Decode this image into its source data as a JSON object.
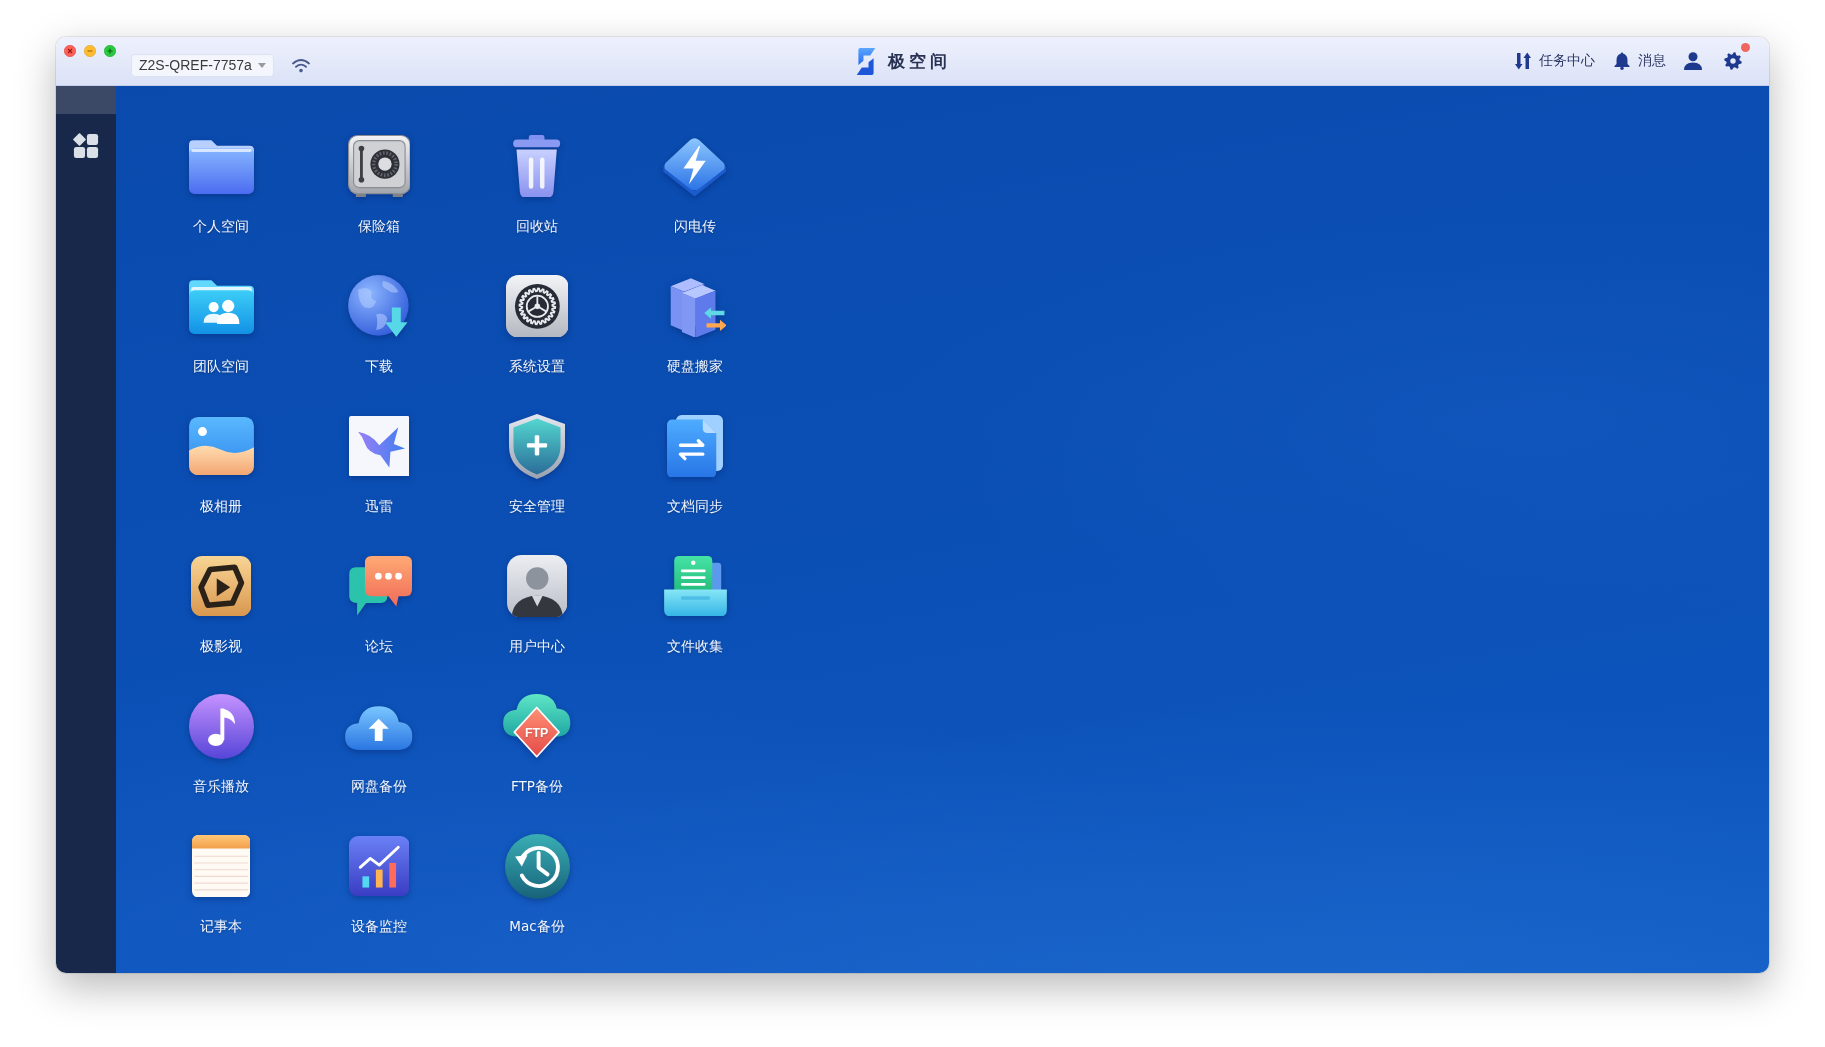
{
  "title_bar": {
    "device": "Z2S-QREF-7757a",
    "title": "极空间",
    "actions": [
      {
        "kind": "tasks",
        "label": "任务中心"
      },
      {
        "kind": "messages",
        "label": "消息"
      },
      {
        "kind": "account"
      },
      {
        "kind": "settings",
        "badge": true
      }
    ]
  },
  "sidebar": {
    "items": [
      {
        "kind": "apps"
      }
    ]
  },
  "desktop": {
    "rows": [
      [
        {
          "label": "个人空间",
          "kind": "folder"
        },
        {
          "label": "保险箱",
          "kind": "safe"
        },
        {
          "label": "回收站",
          "kind": "trash"
        },
        {
          "label": "闪电传",
          "kind": "lightning"
        }
      ],
      [
        {
          "label": "团队空间",
          "kind": "team_folder"
        },
        {
          "label": "下载",
          "kind": "download"
        },
        {
          "label": "系统设置",
          "kind": "settings"
        },
        {
          "label": "硬盘搬家",
          "kind": "drives"
        }
      ],
      [
        {
          "label": "极相册",
          "kind": "photos"
        },
        {
          "label": "迅雷",
          "kind": "bird"
        },
        {
          "label": "安全管理",
          "kind": "shield"
        },
        {
          "label": "文档同步",
          "kind": "doc_sync"
        }
      ],
      [
        {
          "label": "极影视",
          "kind": "video"
        },
        {
          "label": "论坛",
          "kind": "chat"
        },
        {
          "label": "用户中心",
          "kind": "user"
        },
        {
          "label": "文件收集",
          "kind": "collect"
        }
      ],
      [
        {
          "label": "音乐播放",
          "kind": "music"
        },
        {
          "label": "网盘备份",
          "kind": "cloud"
        },
        {
          "label": "FTP备份",
          "kind": "ftp",
          "icon_text": "FTP"
        }
      ],
      [
        {
          "label": "记事本",
          "kind": "notes"
        },
        {
          "label": "设备监控",
          "kind": "monitor"
        },
        {
          "label": "Mac备份",
          "kind": "backup"
        }
      ]
    ]
  }
}
